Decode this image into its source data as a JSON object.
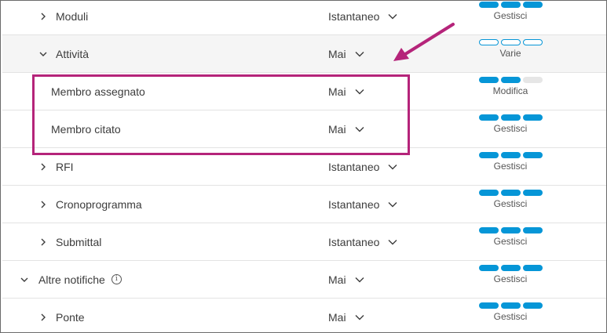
{
  "colors": {
    "accent": "#0696d7",
    "highlight": "#b5247a"
  },
  "rows": [
    {
      "label": "Moduli",
      "chevron": "chevron-right-icon",
      "frequency": "Istantaneo",
      "permission": "Gestisci",
      "pills": [
        "full",
        "full",
        "full"
      ]
    },
    {
      "label": "Attività",
      "chevron": "chevron-down-icon",
      "frequency": "Mai",
      "permission": "Varie",
      "pills": [
        "empty",
        "empty",
        "empty"
      ]
    },
    {
      "label": "Membro assegnato",
      "chevron": null,
      "frequency": "Mai",
      "permission": "Modifica",
      "pills": [
        "full",
        "full",
        "gray"
      ]
    },
    {
      "label": "Membro citato",
      "chevron": null,
      "frequency": "Mai",
      "permission": "Gestisci",
      "pills": [
        "full",
        "full",
        "full"
      ]
    },
    {
      "label": "RFI",
      "chevron": "chevron-right-icon",
      "frequency": "Istantaneo",
      "permission": "Gestisci",
      "pills": [
        "full",
        "full",
        "full"
      ]
    },
    {
      "label": "Cronoprogramma",
      "chevron": "chevron-right-icon",
      "frequency": "Istantaneo",
      "permission": "Gestisci",
      "pills": [
        "full",
        "full",
        "full"
      ]
    },
    {
      "label": "Submittal",
      "chevron": "chevron-right-icon",
      "frequency": "Istantaneo",
      "permission": "Gestisci",
      "pills": [
        "full",
        "full",
        "full"
      ]
    },
    {
      "label": "Altre notifiche",
      "chevron": "chevron-down-icon",
      "frequency": "Mai",
      "permission": "Gestisci",
      "pills": [
        "full",
        "full",
        "full"
      ],
      "info_icon": "info-icon"
    },
    {
      "label": "Ponte",
      "chevron": "chevron-right-icon",
      "frequency": "Mai",
      "permission": "Gestisci",
      "pills": [
        "full",
        "full",
        "full"
      ]
    }
  ]
}
